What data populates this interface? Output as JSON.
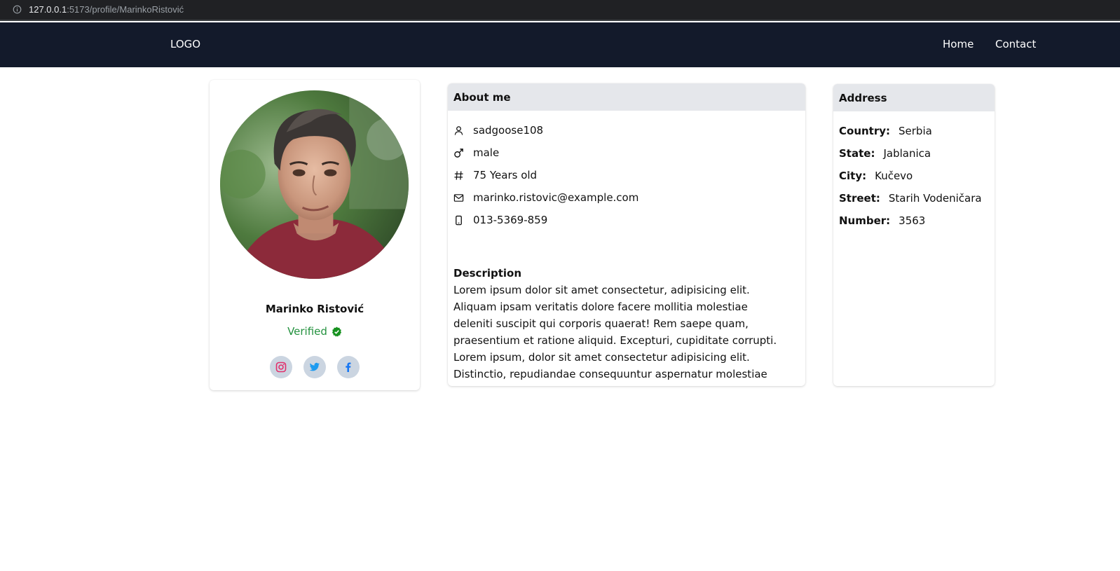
{
  "browser": {
    "url_host": "127.0.0.1",
    "url_rest": ":5173/profile/MarinkoRistović"
  },
  "nav": {
    "logo": "LOGO",
    "links": [
      "Home",
      "Contact"
    ]
  },
  "profile": {
    "name": "Marinko Ristović",
    "status": "Verified",
    "status_color": "#23913e",
    "socials": [
      {
        "icon": "instagram-icon",
        "color": "#e1306c"
      },
      {
        "icon": "twitter-icon",
        "color": "#1d9bf0"
      },
      {
        "icon": "facebook-icon",
        "color": "#1877f2"
      }
    ]
  },
  "about": {
    "title": "About me",
    "rows": [
      {
        "icon": "user-icon",
        "value": "sadgoose108"
      },
      {
        "icon": "male-icon",
        "value": "male"
      },
      {
        "icon": "hash-icon",
        "value": "75 Years old"
      },
      {
        "icon": "mail-icon",
        "value": "marinko.ristovic@example.com"
      },
      {
        "icon": "phone-icon",
        "value": "013-5369-859"
      }
    ],
    "description_title": "Description",
    "description": "Lorem ipsum dolor sit amet consectetur, adipisicing elit. Aliquam ipsam veritatis dolore facere mollitia molestiae deleniti suscipit qui corporis quaerat! Rem saepe quam, praesentium et ratione aliquid. Excepturi, cupiditate corrupti. Lorem ipsum, dolor sit amet consectetur adipisicing elit. Distinctio, repudiandae consequuntur aspernatur molestiae eligendi iusto"
  },
  "address": {
    "title": "Address",
    "rows": [
      {
        "label": "Country:",
        "value": "Serbia"
      },
      {
        "label": "State:",
        "value": "Jablanica"
      },
      {
        "label": "City:",
        "value": "Kučevo"
      },
      {
        "label": "Street:",
        "value": "Starih Vodeničara"
      },
      {
        "label": "Number:",
        "value": "3563"
      }
    ]
  },
  "colors": {
    "navbar_bg": "#131a2b",
    "card_header_bg": "#e5e7eb",
    "social_bg": "#cbd5e1"
  }
}
